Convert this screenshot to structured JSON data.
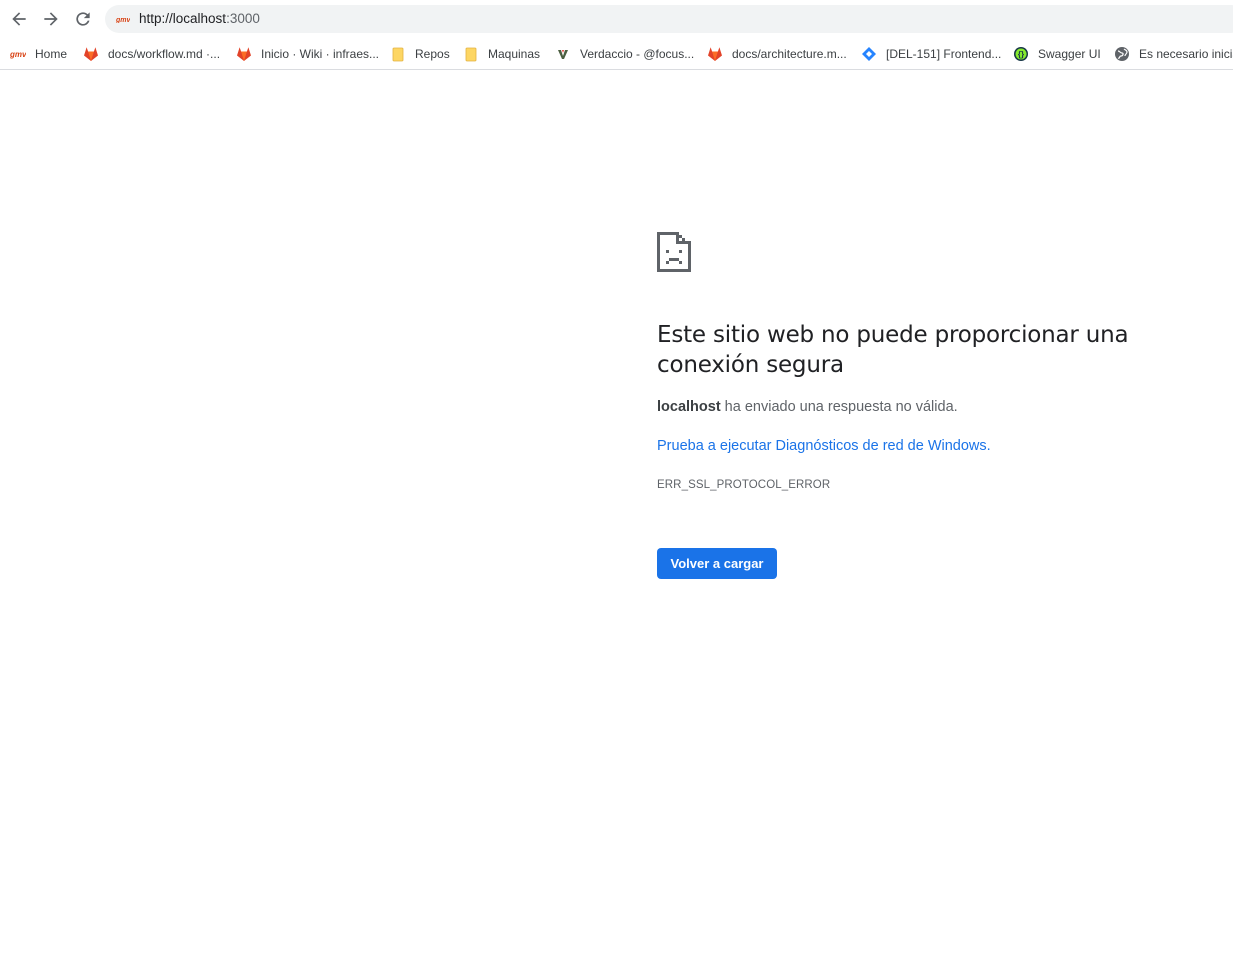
{
  "browser": {
    "url_host": "http://localhost",
    "url_rest": ":3000",
    "site_icon": "gmv-logo-icon",
    "colors": {
      "accent": "#1a73e8",
      "toolbar_icon": "#5f6368",
      "omnibox_bg": "#f1f3f4"
    }
  },
  "bookmarks": [
    {
      "label": "Home",
      "icon": "gmv-logo-icon"
    },
    {
      "label": "docs/workflow.md ·...",
      "icon": "gitlab-icon"
    },
    {
      "label": "Inicio · Wiki · infraes...",
      "icon": "gitlab-icon"
    },
    {
      "label": "Repos",
      "icon": "folder-icon"
    },
    {
      "label": "Maquinas",
      "icon": "folder-icon"
    },
    {
      "label": "Verdaccio - @focus...",
      "icon": "verdaccio-icon"
    },
    {
      "label": "docs/architecture.m...",
      "icon": "gitlab-icon"
    },
    {
      "label": "[DEL-151] Frontend...",
      "icon": "jira-icon"
    },
    {
      "label": "Swagger UI",
      "icon": "swagger-icon"
    },
    {
      "label": "Es necesario inicia",
      "icon": "globe-icon"
    }
  ],
  "error_page": {
    "icon": "sad-document-icon",
    "title": "Este sitio web no puede proporcionar una conexión segura",
    "host": "localhost",
    "message": " ha enviado una respuesta no válida.",
    "link": "Prueba a ejecutar Diagnósticos de red de Windows.",
    "error_code": "ERR_SSL_PROTOCOL_ERROR",
    "reload_label": "Volver a cargar"
  }
}
